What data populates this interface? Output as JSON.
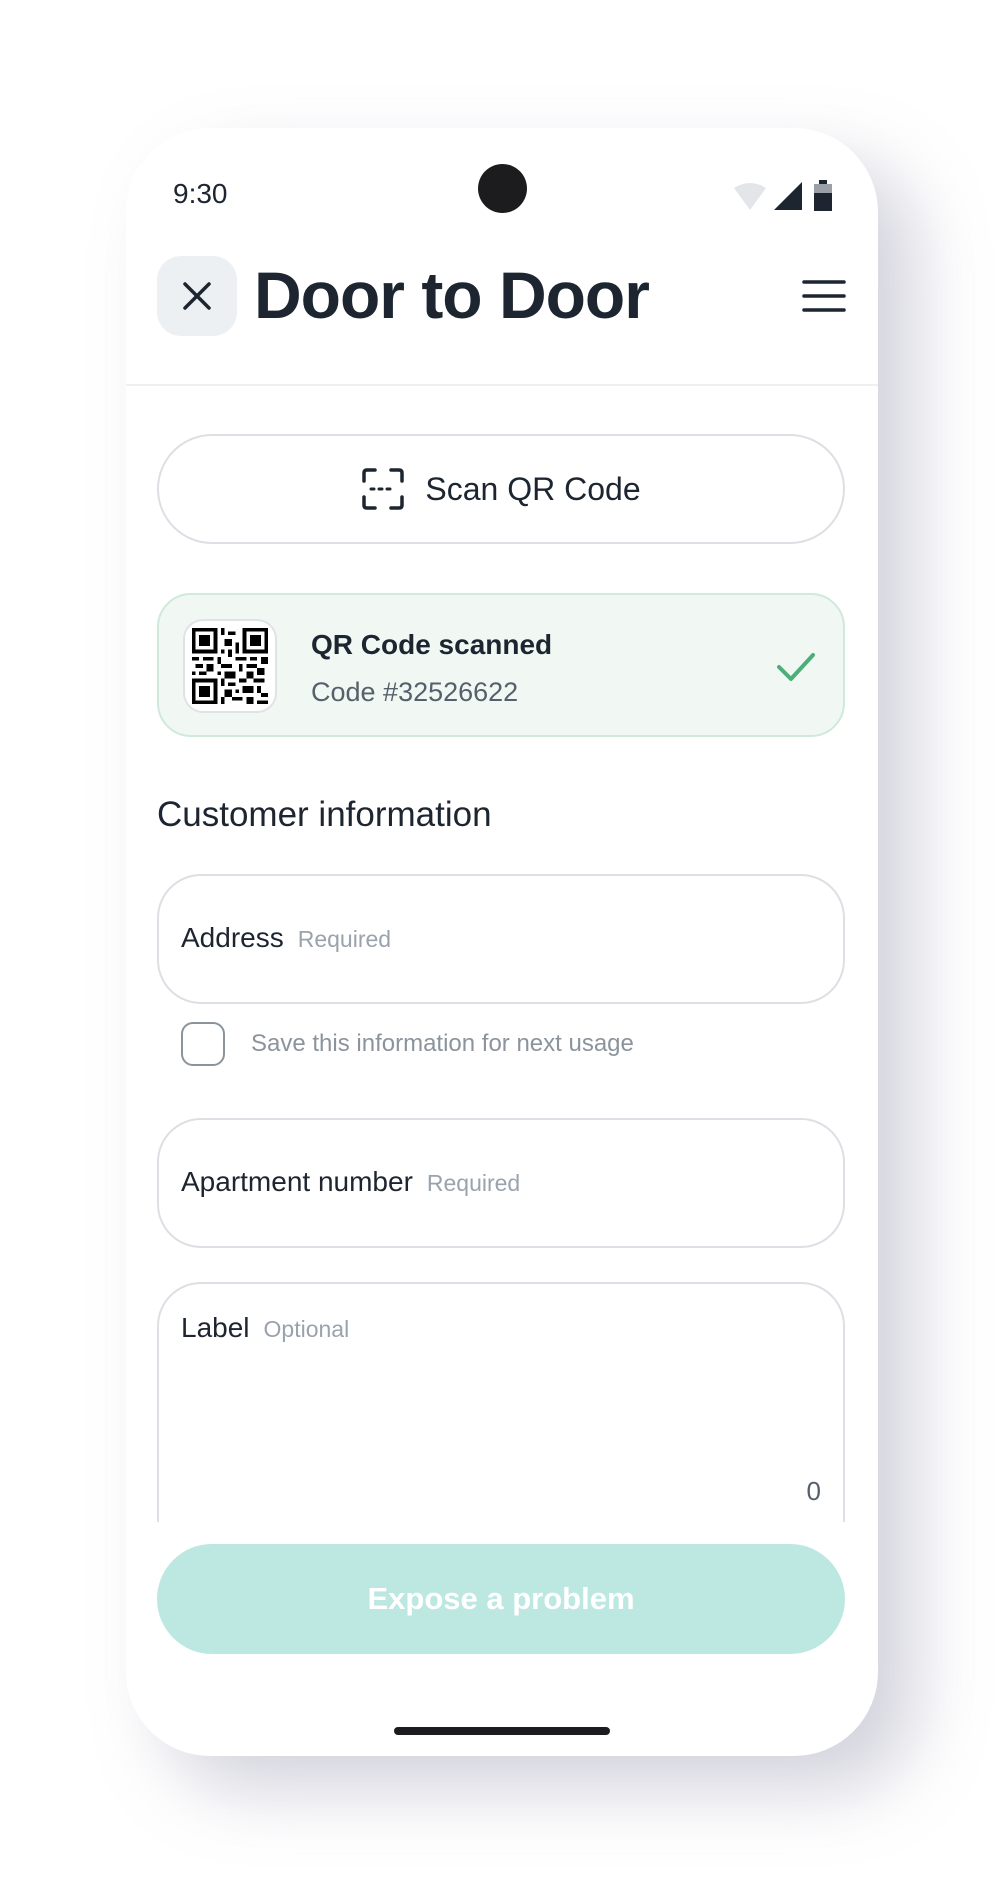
{
  "status_bar": {
    "time": "9:30"
  },
  "header": {
    "title": "Door to Door",
    "close_icon": "close-icon",
    "menu_icon": "menu-icon"
  },
  "scan_button": {
    "label": "Scan QR Code",
    "icon": "qr-scan-icon"
  },
  "scanned_card": {
    "title": "QR Code scanned",
    "code": "Code #32526622",
    "status_color": "#4caf78"
  },
  "section": {
    "title": "Customer information"
  },
  "fields": {
    "address": {
      "label": "Address",
      "hint": "Required"
    },
    "apartment": {
      "label": "Apartment number",
      "hint": "Required"
    },
    "label": {
      "label": "Label",
      "hint": "Optional",
      "counter": "0"
    }
  },
  "save_option": {
    "text": "Save this information for next usage",
    "checked": false
  },
  "problem_button": {
    "label": "Expose a problem",
    "color": "#bde8e2",
    "enabled": false
  }
}
